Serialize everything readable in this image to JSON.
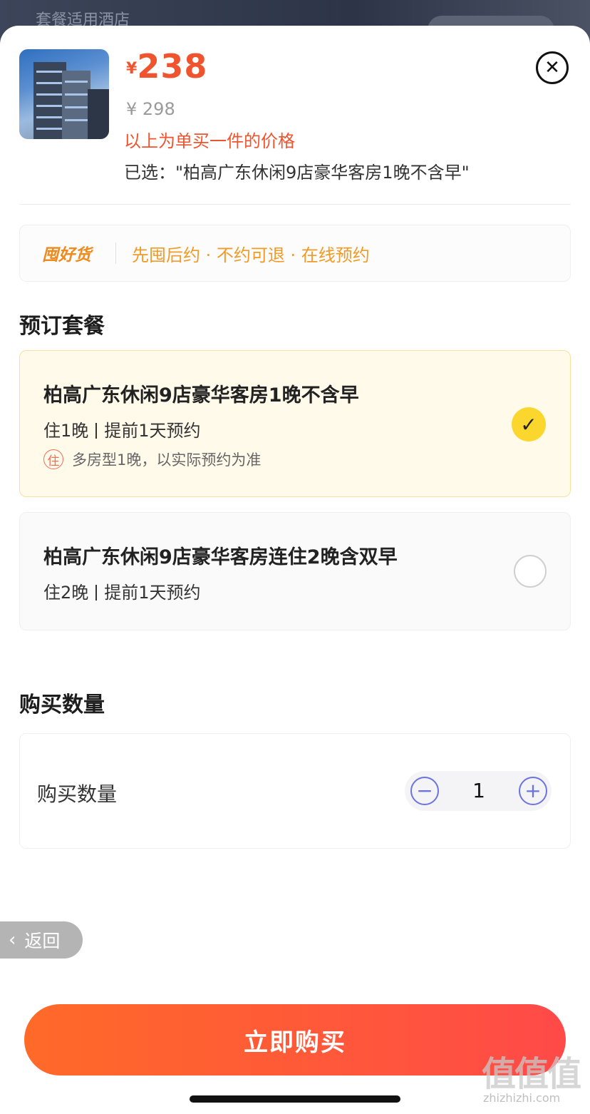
{
  "backdrop": {
    "title": "套餐适用酒店"
  },
  "product": {
    "currency": "¥",
    "price": "238",
    "original_price": "¥ 298",
    "note": "以上为单买一件的价格",
    "selected_text": "已选：\"柏高广东休闲9店豪华客房1晚不含早\""
  },
  "promo": {
    "brand": "囤好货",
    "text": "先囤后约 · 不约可退 · 在线预约"
  },
  "packages_section": {
    "title": "预订套餐",
    "items": [
      {
        "name": "柏高广东休闲9店豪华客房1晚不含早",
        "nights": "住1晚",
        "advance": "提前1天预约",
        "badge": "住",
        "extra": "多房型1晚，以实际预约为准",
        "selected": true
      },
      {
        "name": "柏高广东休闲9店豪华客房连住2晚含双早",
        "nights": "住2晚",
        "advance": "提前1天预约",
        "selected": false
      }
    ]
  },
  "quantity_section": {
    "title": "购买数量",
    "label": "购买数量",
    "value": "1",
    "minus": "−",
    "plus": "+"
  },
  "back": {
    "label": "返回"
  },
  "buy_button": {
    "label": "立即购买"
  },
  "watermark": {
    "main": "值值值",
    "sub": "zhizhizhi.com"
  },
  "colors": {
    "accent_red": "#f0542e",
    "promo_orange": "#f29a26",
    "check_yellow": "#fbd62c",
    "stepper_blue": "#6b73e0",
    "buy_gradient_start": "#ff6a28",
    "buy_gradient_end": "#ff4a48"
  },
  "icons": {
    "close": "close-icon",
    "check": "check-icon",
    "radio": "radio-icon",
    "minus": "minus-icon",
    "plus": "plus-icon",
    "back": "chevron-left-icon"
  }
}
